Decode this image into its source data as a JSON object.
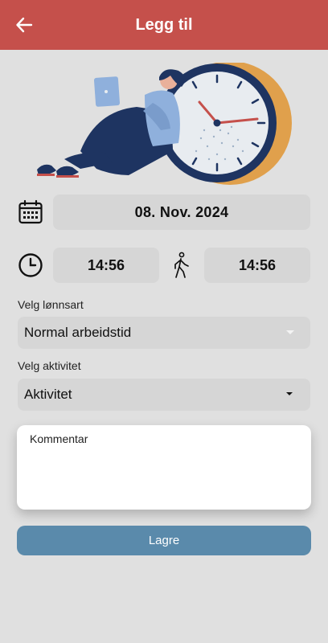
{
  "appbar": {
    "title": "Legg til",
    "color": "#c5504b",
    "back_icon": "arrow-left-icon"
  },
  "illustration": {
    "description_icon": "person-with-laptop-and-clock-illustration"
  },
  "date": {
    "icon": "calendar-icon",
    "value": "08. Nov. 2024"
  },
  "time": {
    "start_icon": "clock-icon",
    "start": "14:56",
    "end_icon": "walking-person-icon",
    "end": "14:56"
  },
  "wage_type": {
    "label": "Velg lønnsart",
    "value": "Normal arbeidstid"
  },
  "activity": {
    "label": "Velg aktivitet",
    "value": "Aktivitet"
  },
  "comment": {
    "placeholder": "Kommentar"
  },
  "save": {
    "label": "Lagre",
    "color": "#5a8aab"
  }
}
